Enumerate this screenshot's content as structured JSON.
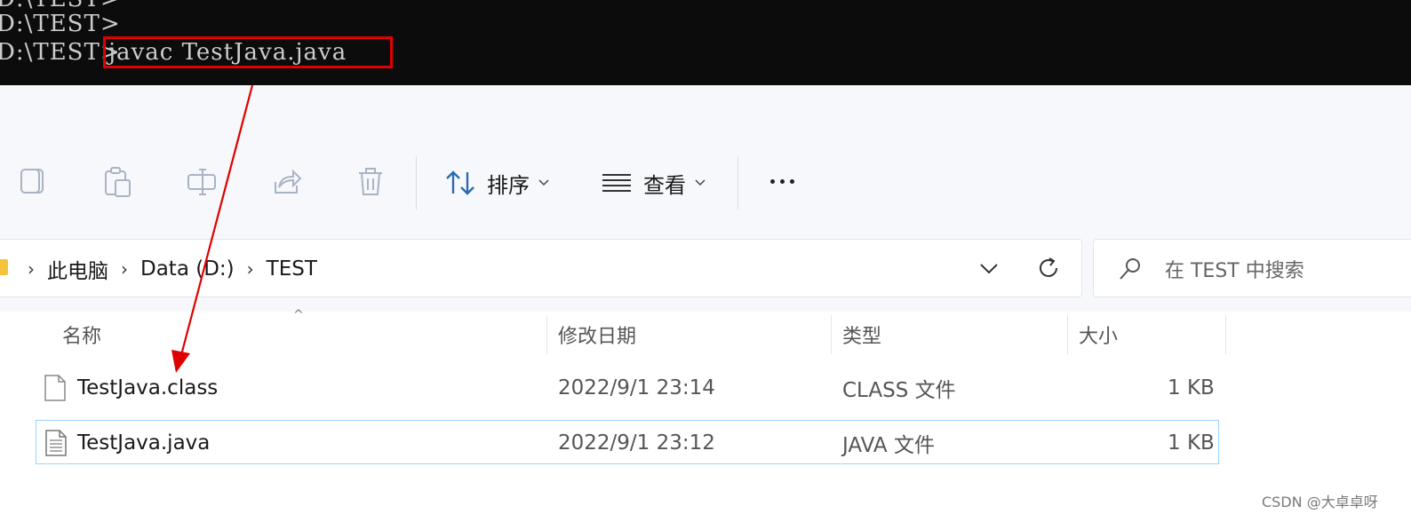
{
  "console": {
    "line0": "D:\\TEST>",
    "line1": "D:\\TEST>",
    "prompt": "D:\\TEST>",
    "command": "javac TestJava.java"
  },
  "toolbar": {
    "sort_label": "排序",
    "view_label": "查看"
  },
  "address": {
    "crumbs": [
      "此电脑",
      "Data (D:)",
      "TEST"
    ]
  },
  "search": {
    "placeholder": "在 TEST 中搜索"
  },
  "columns": {
    "name": "名称",
    "modified": "修改日期",
    "type": "类型",
    "size": "大小"
  },
  "files": [
    {
      "name": "TestJava.class",
      "modified": "2022/9/1 23:14",
      "type": "CLASS 文件",
      "size": "1 KB",
      "icon": "blank-file-icon"
    },
    {
      "name": "TestJava.java",
      "modified": "2022/9/1 23:12",
      "type": "JAVA 文件",
      "size": "1 KB",
      "icon": "text-file-icon"
    }
  ],
  "watermark": "CSDN @大卓卓呀",
  "colors": {
    "highlight_box": "#e00000",
    "arrow": "#e00000",
    "selection_border": "#99d1ff"
  }
}
